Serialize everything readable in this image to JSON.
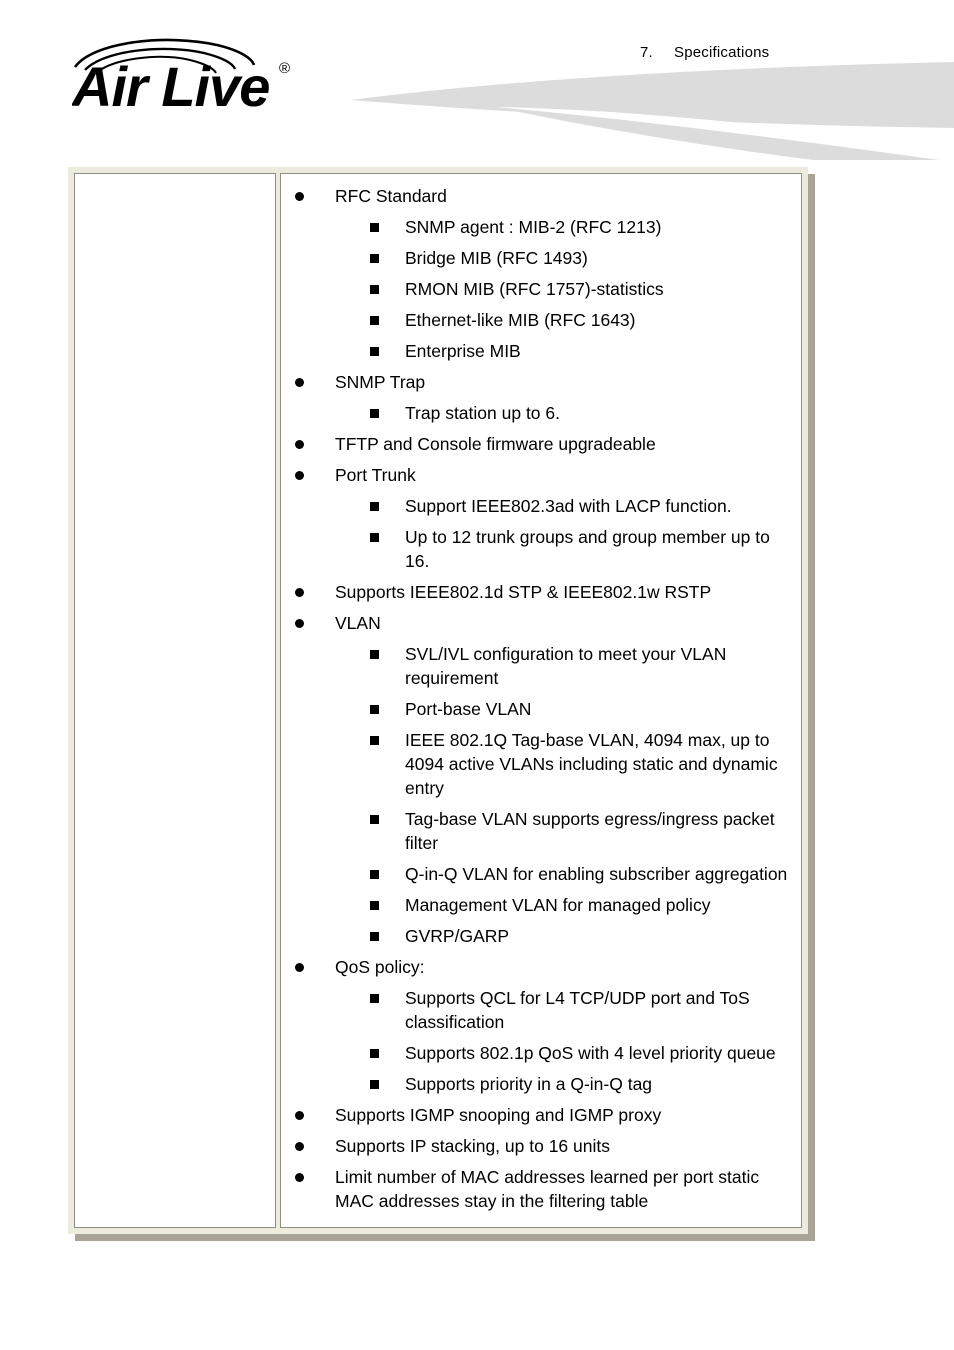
{
  "header": {
    "chapter_number": "7.",
    "chapter_title": "Specifications",
    "logo_text_air": "Air",
    "logo_text_live": "Live",
    "logo_registered_mark": "®",
    "logo_name": "AirLive"
  },
  "table": {
    "left_cell_text": "",
    "items": [
      {
        "label": "RFC Standard",
        "children": [
          "SNMP agent : MIB-2 (RFC 1213)",
          "Bridge MIB (RFC 1493)",
          "RMON MIB (RFC 1757)-statistics",
          "Ethernet-like MIB (RFC 1643)",
          "Enterprise MIB"
        ]
      },
      {
        "label": "SNMP Trap",
        "children": [
          "Trap station up to 6."
        ]
      },
      {
        "label": "TFTP and Console firmware upgradeable",
        "children": []
      },
      {
        "label": "Port Trunk",
        "children": [
          "Support IEEE802.3ad with LACP function.",
          "Up to 12 trunk groups and group member up to 16."
        ]
      },
      {
        "label": "Supports IEEE802.1d STP & IEEE802.1w RSTP",
        "children": []
      },
      {
        "label": "VLAN",
        "children": [
          "SVL/IVL configuration to meet your VLAN requirement",
          "Port-base VLAN",
          "IEEE 802.1Q Tag-base VLAN, 4094 max, up to 4094 active VLANs including static and dynamic entry",
          "Tag-base VLAN supports egress/ingress packet filter",
          "Q-in-Q VLAN for enabling subscriber aggregation",
          "Management VLAN for managed policy",
          "GVRP/GARP"
        ]
      },
      {
        "label": "QoS policy:",
        "children": [
          "Supports QCL for L4 TCP/UDP port and ToS classification",
          "Supports 802.1p QoS with 4 level priority queue",
          "Supports priority in a Q-in-Q tag"
        ]
      },
      {
        "label": "Supports IGMP snooping and IGMP proxy",
        "children": []
      },
      {
        "label": "Supports IP stacking, up to 16 units",
        "children": []
      },
      {
        "label": "Limit number of MAC addresses learned per port static MAC addresses stay in the filtering table",
        "children": []
      }
    ]
  },
  "colors": {
    "table_outer_border": "#edeade",
    "table_inner_border": "#8e8e85",
    "table_shadow": "#a9a396",
    "swoosh": "#dcdcdc",
    "text": "#000000",
    "page_background": "#ffffff"
  }
}
